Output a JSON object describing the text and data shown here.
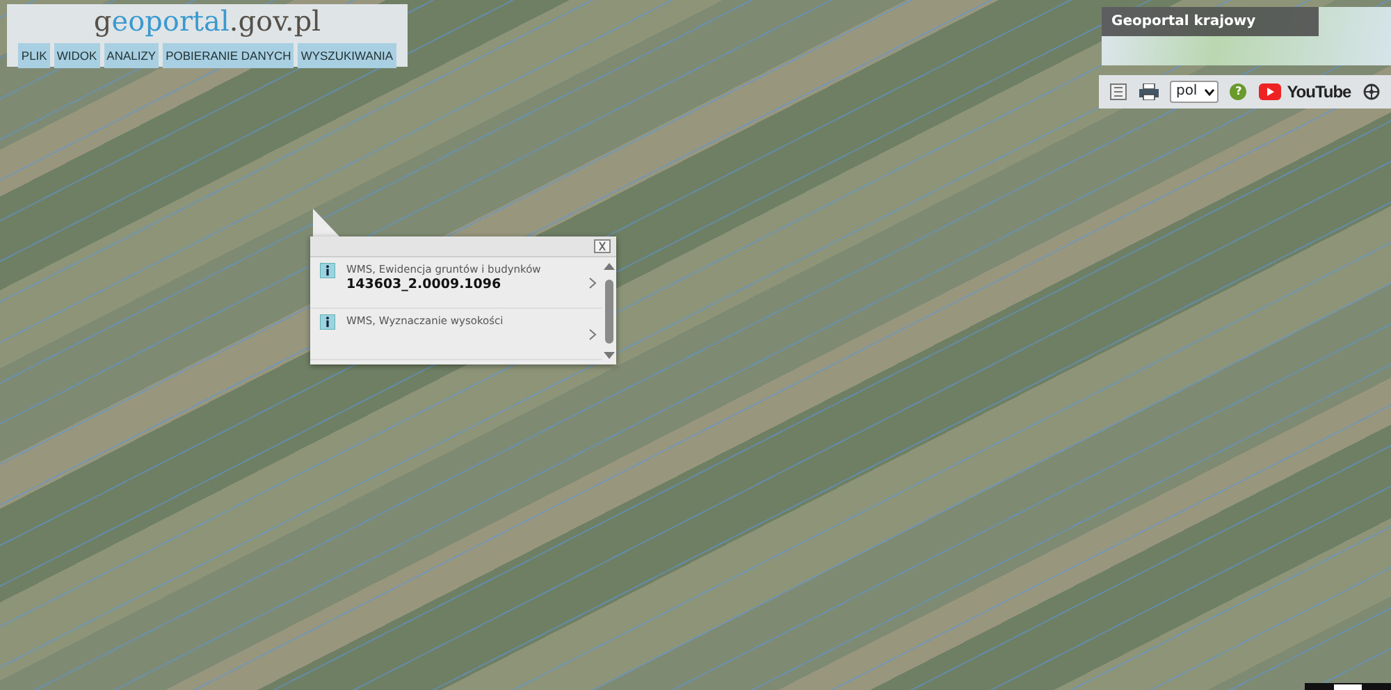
{
  "header": {
    "logo": {
      "prefix": "g",
      "highlight": "eoportal",
      "suffix": ".gov.pl"
    },
    "menu": [
      {
        "label": "PLIK"
      },
      {
        "label": "WIDOK"
      },
      {
        "label": "ANALIZY"
      },
      {
        "label": "POBIERANIE DANYCH"
      },
      {
        "label": "WYSZUKIWANIA"
      }
    ]
  },
  "overview_map": {
    "title": "Geoportal krajowy"
  },
  "toolbar": {
    "language": "pol",
    "help": "?",
    "video": "YouTube"
  },
  "popup": {
    "items": [
      {
        "source": "WMS, Ewidencja gruntów i budynków",
        "value": "143603_2.0009.1096"
      },
      {
        "source": "WMS, Wyznaczanie wysokości"
      }
    ]
  }
}
